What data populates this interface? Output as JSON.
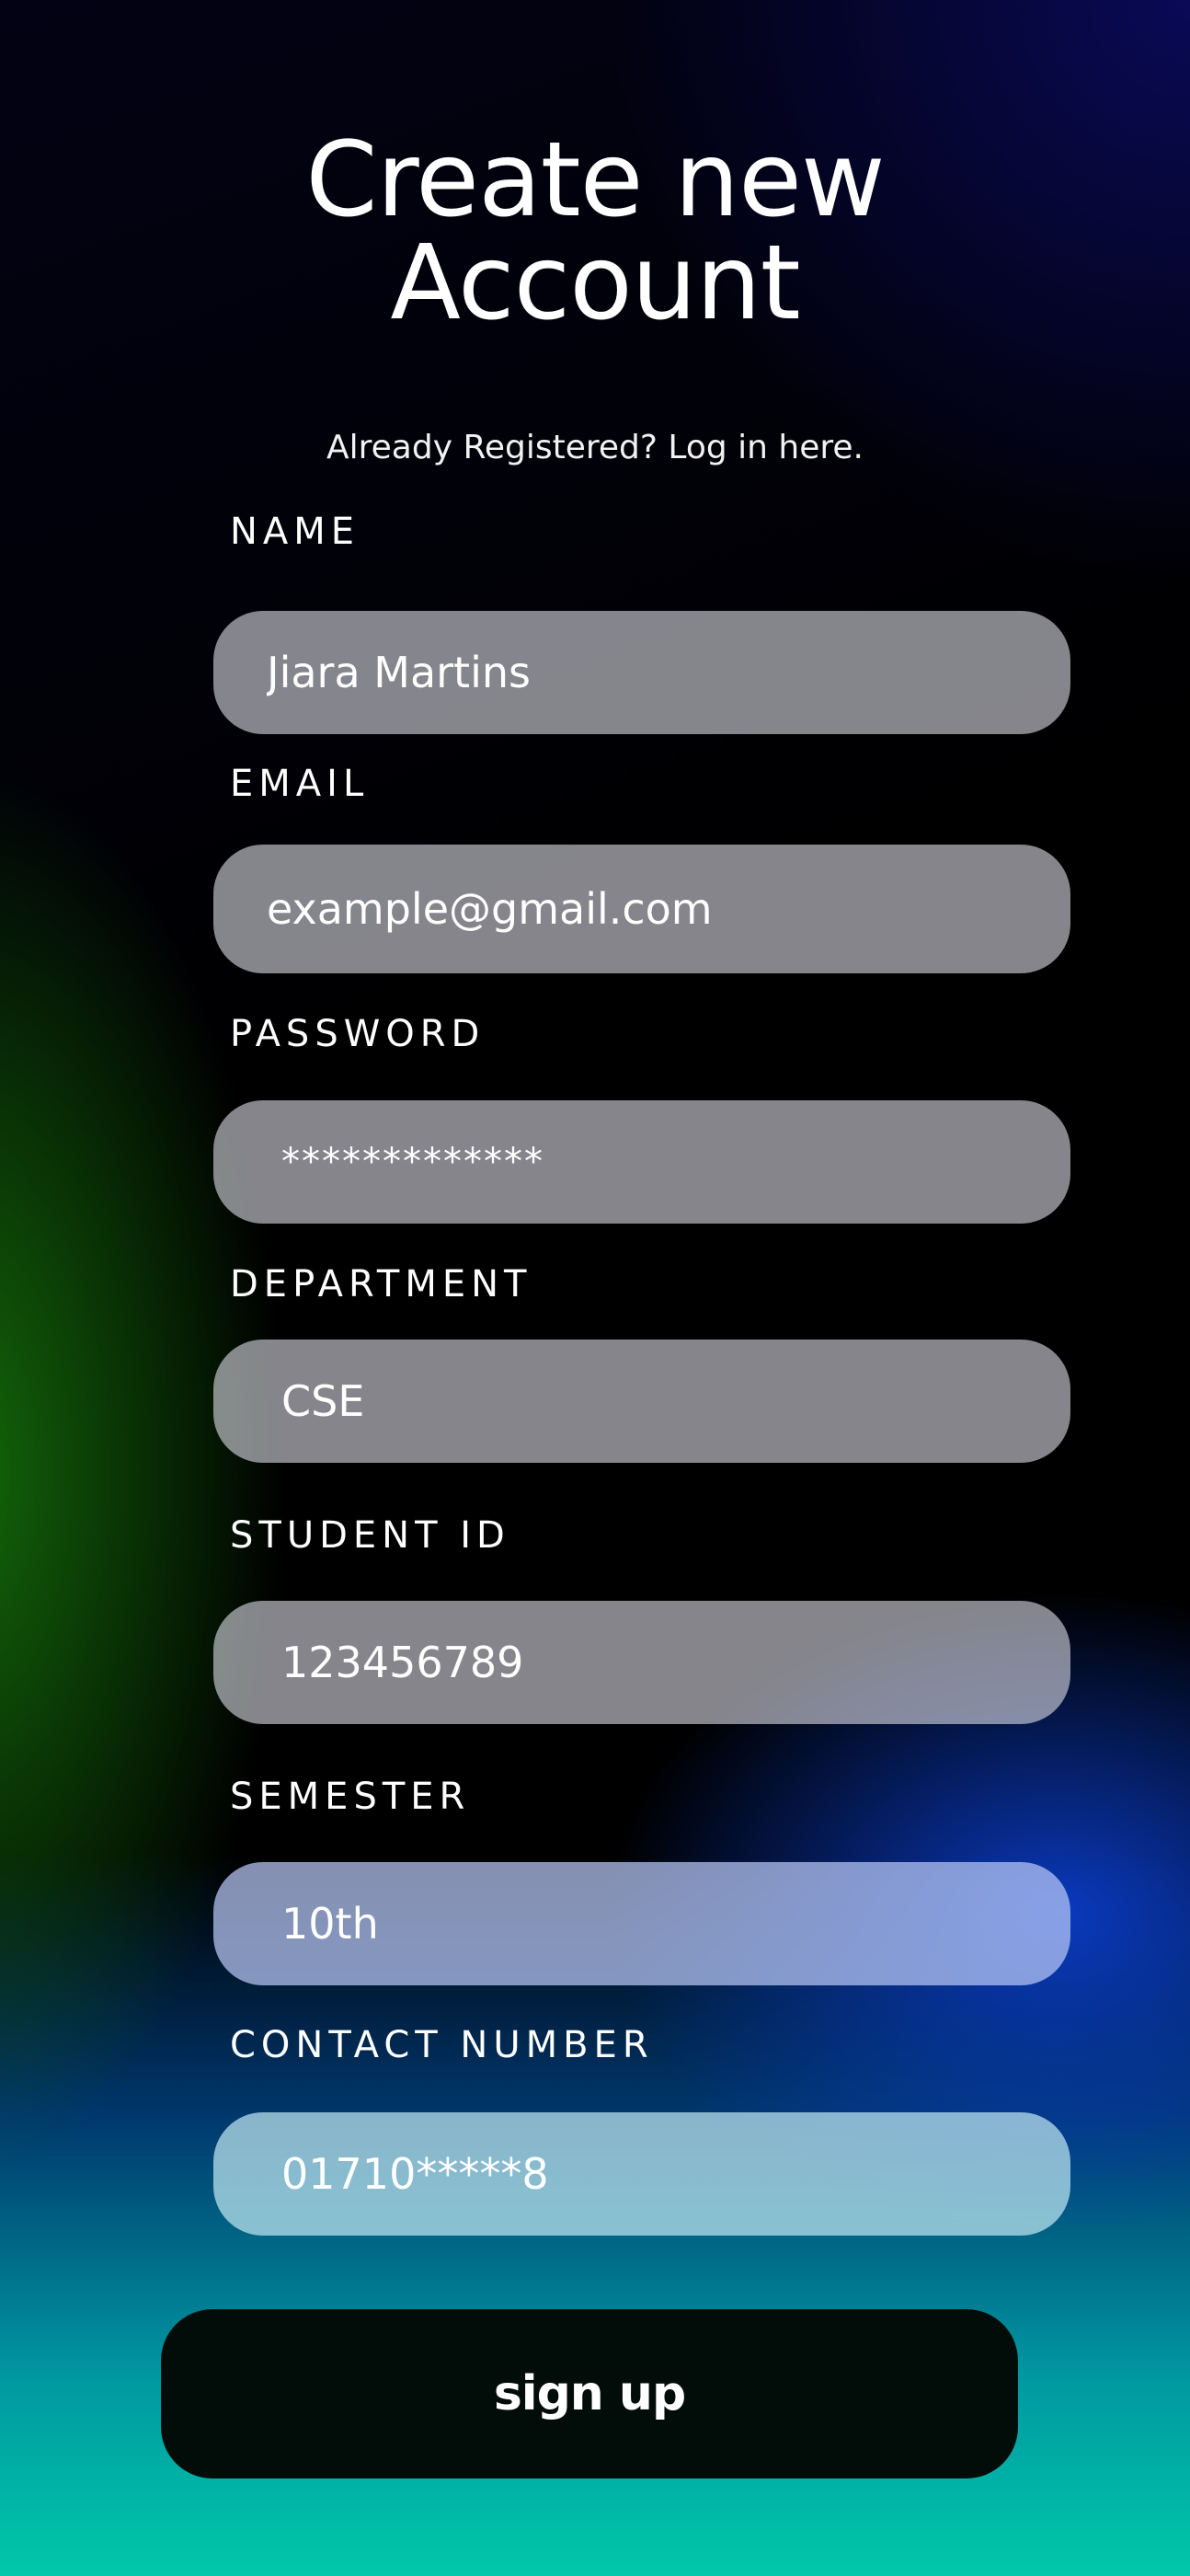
{
  "header": {
    "title_line1": "Create new",
    "title_line2": "Account",
    "login_link": "Already Registered? Log in here."
  },
  "form": {
    "name": {
      "label": "NAME",
      "value": "Jiara Martins"
    },
    "email": {
      "label": "EMAIL",
      "placeholder": "example@gmail.com"
    },
    "password": {
      "label": "PASSWORD",
      "value": "*************"
    },
    "department": {
      "label": "DEPARTMENT",
      "value": "CSE"
    },
    "student_id": {
      "label": "STUDENT ID",
      "value": "123456789"
    },
    "semester": {
      "label": "SEMESTER",
      "value": "10th"
    },
    "contact": {
      "label": "CONTACT NUMBER",
      "value": "01710*****8"
    },
    "submit_label": "sign up"
  },
  "colors": {
    "text": "#ffffff",
    "field_fill": "#d7d7e1",
    "button_fill": "#020d09",
    "bottom_accent": "#00c8aa"
  }
}
